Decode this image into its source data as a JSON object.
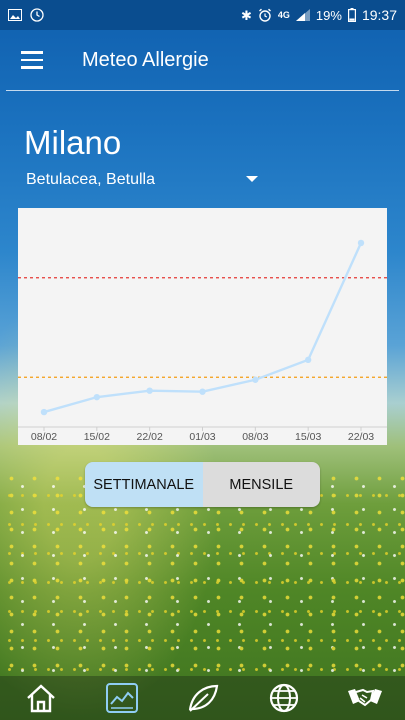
{
  "status_bar": {
    "battery": "19%",
    "time": "19:37",
    "network": "4G"
  },
  "app_bar": {
    "title": "Meteo Allergie"
  },
  "location": {
    "city": "Milano"
  },
  "pollen_selector": {
    "selected": "Betulacea, Betulla"
  },
  "chart_data": {
    "type": "line",
    "categories": [
      "08/02",
      "15/02",
      "22/02",
      "01/03",
      "08/03",
      "15/03",
      "22/03"
    ],
    "series": [
      {
        "values": [
          3,
          6,
          7.3,
          7.1,
          9.5,
          13.5,
          37
        ]
      }
    ],
    "ylim": [
      0,
      40
    ],
    "thresholds": [
      {
        "value": 10,
        "color": "#f39c12"
      },
      {
        "value": 30,
        "color": "#e53935"
      }
    ],
    "line_color": "#bfe0fb",
    "grid": false
  },
  "period_toggle": {
    "weekly_label": "SETTIMANALE",
    "monthly_label": "MENSILE",
    "active": "weekly"
  },
  "bottom_nav": {
    "items": [
      {
        "icon": "home-icon"
      },
      {
        "icon": "chart-icon",
        "active": true
      },
      {
        "icon": "leaf-icon"
      },
      {
        "icon": "globe-icon"
      },
      {
        "icon": "handshake-icon"
      }
    ]
  }
}
